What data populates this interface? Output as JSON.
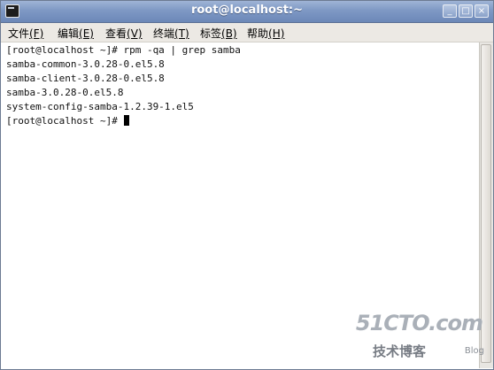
{
  "window": {
    "title": "root@localhost:~",
    "controls": {
      "minimize": "_",
      "maximize": "□",
      "close": "×"
    }
  },
  "menubar": {
    "items": [
      {
        "label": "文件",
        "mnemonic": "(F)"
      },
      {
        "label": "编辑",
        "mnemonic": "(E)"
      },
      {
        "label": "查看",
        "mnemonic": "(V)"
      },
      {
        "label": "终端",
        "mnemonic": "(T)"
      },
      {
        "label": "标签",
        "mnemonic": "(B)"
      },
      {
        "label": "帮助",
        "mnemonic": "(H)"
      }
    ]
  },
  "terminal": {
    "lines": [
      "[root@localhost ~]# rpm -qa | grep samba",
      "samba-common-3.0.28-0.el5.8",
      "samba-client-3.0.28-0.el5.8",
      "samba-3.0.28-0.el5.8",
      "system-config-samba-1.2.39-1.el5",
      "[root@localhost ~]# "
    ]
  },
  "watermark": {
    "logo": "51CTO.com",
    "subtitle": "技术博客",
    "blog": "Blog"
  },
  "colors": {
    "titlebar": "#7e98c4",
    "menubar": "#ece9e4",
    "terminal_bg": "#ffffff",
    "terminal_fg": "#111111"
  }
}
